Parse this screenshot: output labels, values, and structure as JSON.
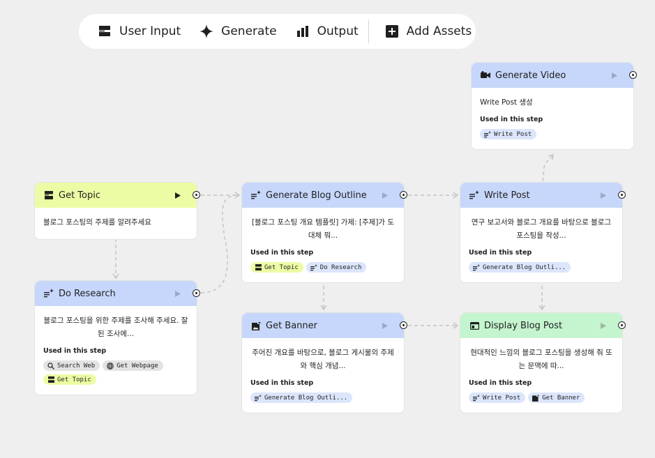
{
  "toolbar": {
    "user_input_label": "User Input",
    "generate_label": "Generate",
    "output_label": "Output",
    "add_assets_label": "Add Assets"
  },
  "used_label": "Used in this step",
  "nodes": {
    "get_topic": {
      "title": "Get Topic",
      "text": "블로그 포스팅의 주제를 알려주세요"
    },
    "do_research": {
      "title": "Do Research",
      "text": "블로그 포스팅을 위한 주제를 조사해 주세요. 잘 된 조사에...",
      "chips": [
        "Search Web",
        "Get Webpage",
        "Get Topic"
      ]
    },
    "generate_blog_outline": {
      "title": "Generate Blog Outline",
      "text": "[블로그 포스팅 개요 템플릿] 가제: [주제]가 도대체 뭐...",
      "chips": [
        "Get Topic",
        "Do Research"
      ]
    },
    "get_banner": {
      "title": "Get Banner",
      "text": "주어진 개요를 바탕으로, 블로그 게시물의 주제와 핵심 개념...",
      "chips": [
        "Generate Blog Outli..."
      ]
    },
    "write_post": {
      "title": "Write Post",
      "text": "연구 보고서와 블로그 개요를 바탕으로 블로그 포스팅을 작성...",
      "chips": [
        "Generate Blog Outli..."
      ]
    },
    "display_blog_post": {
      "title": "Display Blog Post",
      "text": "현대적인 느낌의 블로그 포스팅을 생성해 줘 또는 문맥에 따...",
      "chips": [
        "Write Post",
        "Get Banner"
      ]
    },
    "generate_video": {
      "title": "Generate Video",
      "text": "Write Post 생성",
      "chips": [
        "Write Post"
      ]
    }
  },
  "colors": {
    "canvas": "#efefef",
    "header_generate": "#c7d7fb",
    "header_input": "#ecfca4",
    "header_output": "#c4f5cf",
    "chip_step": "#dbe5fb",
    "chip_tool": "#e3e3e3",
    "connector": "#c4c4c4"
  }
}
